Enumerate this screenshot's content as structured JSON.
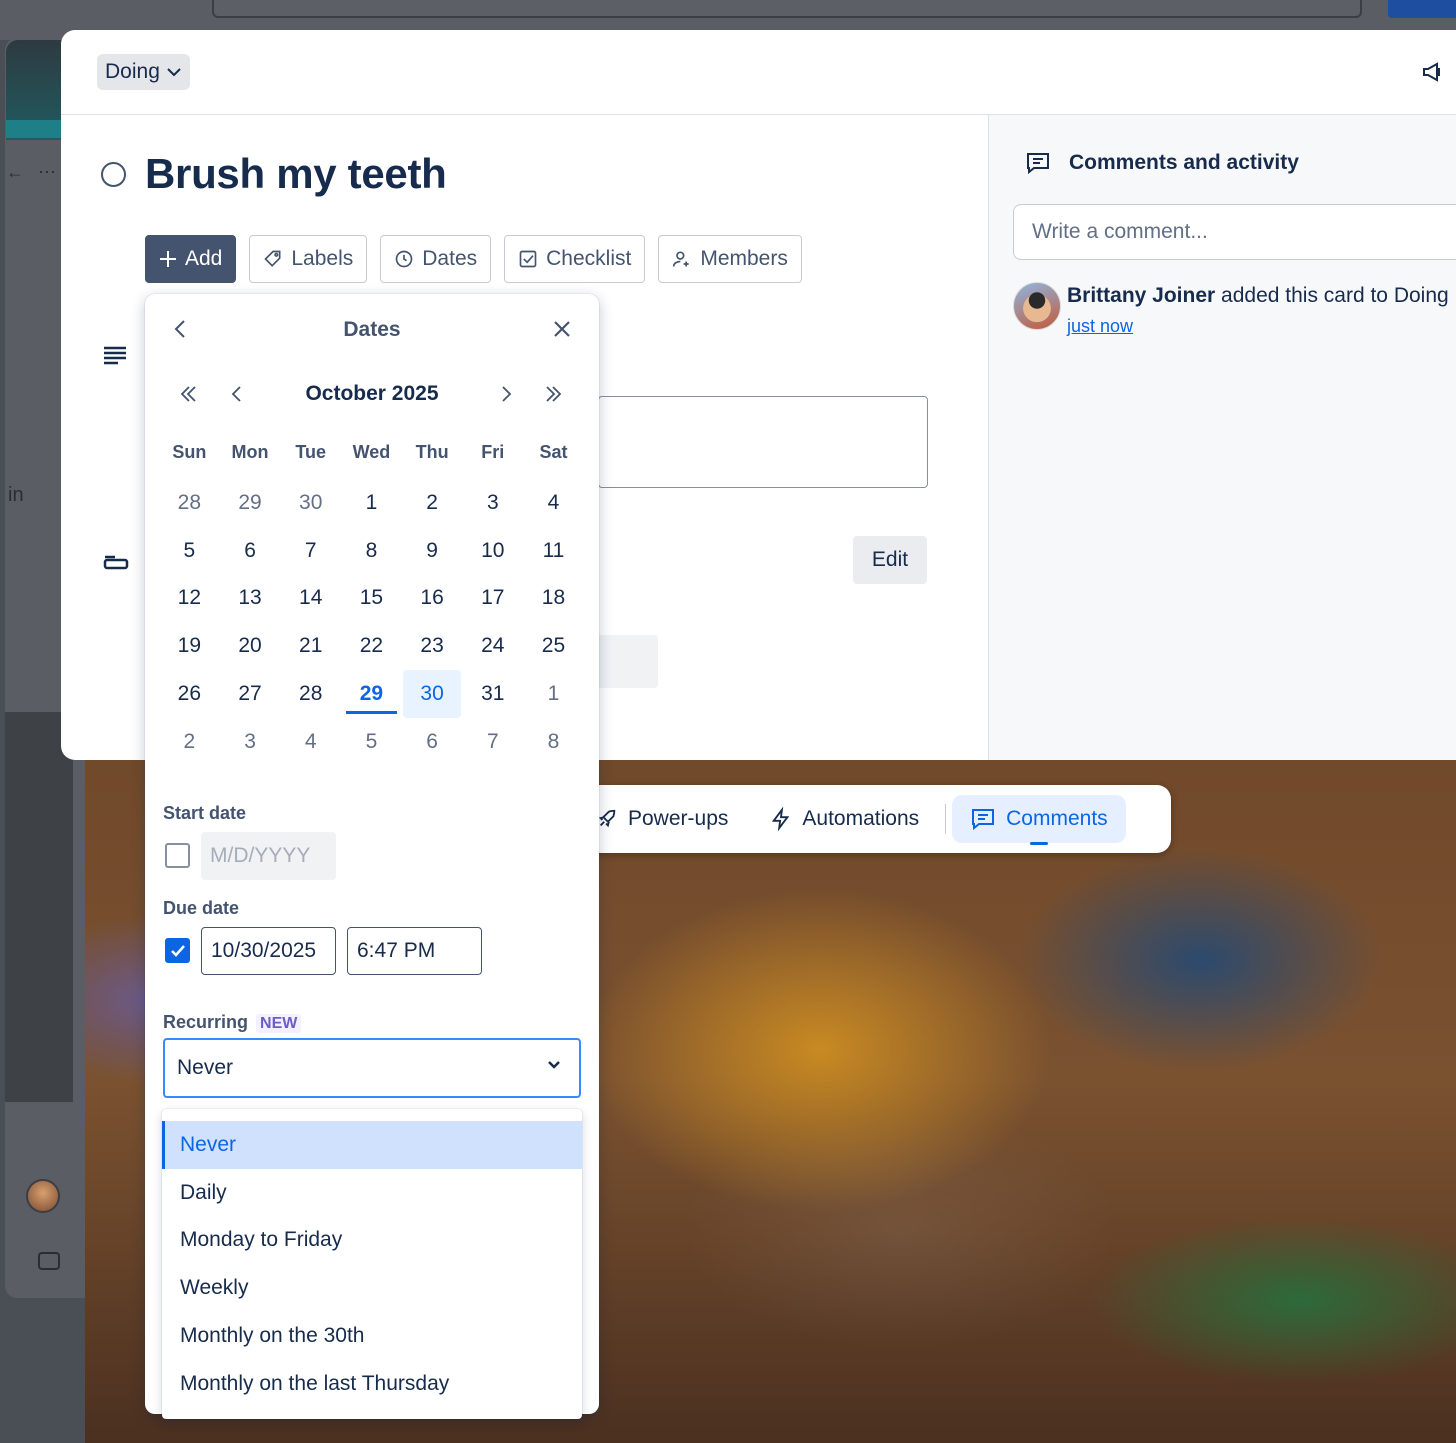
{
  "status": {
    "label": "Doing"
  },
  "card": {
    "title": "Brush my teeth"
  },
  "actions": [
    "Add",
    "Labels",
    "Dates",
    "Checklist",
    "Members"
  ],
  "edit_label": "Edit",
  "comments": {
    "title": "Comments and activity",
    "placeholder": "Write a comment...",
    "activity_user": "Brittany Joiner",
    "activity_action": " added this card to Doing",
    "activity_time": "just now"
  },
  "bottom_nav": [
    "Power-ups",
    "Automations",
    "Comments"
  ],
  "background_text": "in",
  "dates_popover": {
    "title": "Dates",
    "month": "October 2025",
    "weekdays": [
      "Sun",
      "Mon",
      "Tue",
      "Wed",
      "Thu",
      "Fri",
      "Sat"
    ],
    "days": [
      [
        "28",
        "29",
        "30",
        "1",
        "2",
        "3",
        "4"
      ],
      [
        "5",
        "6",
        "7",
        "8",
        "9",
        "10",
        "11"
      ],
      [
        "12",
        "13",
        "14",
        "15",
        "16",
        "17",
        "18"
      ],
      [
        "19",
        "20",
        "21",
        "22",
        "23",
        "24",
        "25"
      ],
      [
        "26",
        "27",
        "28",
        "29",
        "30",
        "31",
        "1"
      ],
      [
        "2",
        "3",
        "4",
        "5",
        "6",
        "7",
        "8"
      ]
    ],
    "today": "29",
    "selected": "30",
    "start_label": "Start date",
    "start_placeholder": "M/D/YYYY",
    "start_checked": false,
    "due_label": "Due date",
    "due_checked": true,
    "due_date": "10/30/2025",
    "due_time": "6:47 PM",
    "recurring_label": "Recurring",
    "new_badge": "NEW",
    "recurring_value": "Never",
    "recurring_options": [
      "Never",
      "Daily",
      "Monday to Friday",
      "Weekly",
      "Monthly on the 30th",
      "Monthly on the last Thursday"
    ]
  },
  "colors": {
    "accent": "#0c66e4",
    "selected_bg": "#e9f2ff",
    "badge": "#6e5dc6"
  }
}
